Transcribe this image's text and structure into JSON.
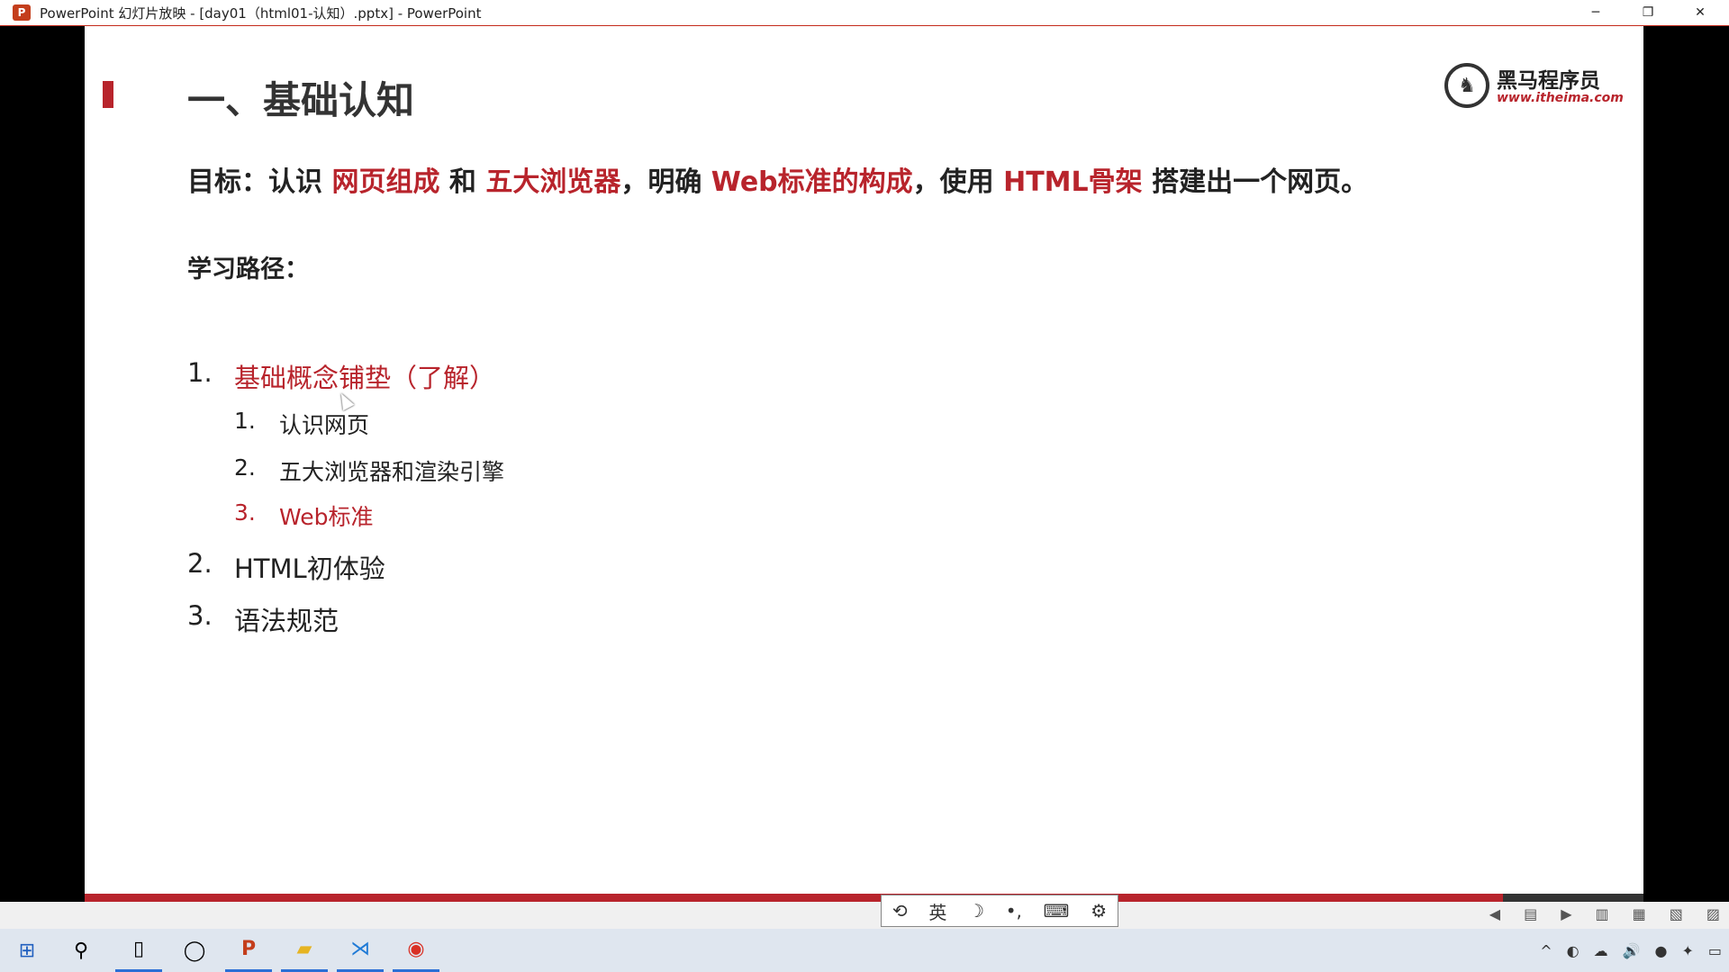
{
  "window": {
    "title": "PowerPoint 幻灯片放映 - [day01（html01-认知）.pptx] - PowerPoint",
    "app_icon": "P",
    "minimize": "─",
    "restore": "❐",
    "close": "✕"
  },
  "slide": {
    "heading": "一、基础认知",
    "logo": {
      "name": "黑马程序员",
      "url": "www.itheima.com",
      "icon": "horse-logo-icon"
    },
    "goal": {
      "p1": "目标：认识 ",
      "h1": "网页组成",
      "p2": " 和 ",
      "h2": "五大浏览器",
      "p3": "，明确 ",
      "h3": "Web标准的构成",
      "p4": "，使用 ",
      "h4": "HTML骨架",
      "p5": " 搭建出一个网页。"
    },
    "path_label": "学习路径：",
    "outline": [
      {
        "num": "1.",
        "text": "基础概念铺垫（了解）",
        "children": [
          {
            "num": "1.",
            "text": "认识网页"
          },
          {
            "num": "2.",
            "text": "五大浏览器和渲染引擎"
          },
          {
            "num": "3.",
            "text": "Web标准"
          }
        ]
      },
      {
        "num": "2.",
        "text": "HTML初体验"
      },
      {
        "num": "3.",
        "text": "语法规范"
      }
    ],
    "progress": 0.91
  },
  "ime_toolbar": {
    "logo": "⟲",
    "lang": "英",
    "moon": "☽",
    "punct": "•,",
    "keyboard": "⌨",
    "settings": "⚙"
  },
  "status_icons": [
    "◀",
    "▤",
    "▶",
    "▥",
    "▦",
    "▧",
    "▨"
  ],
  "taskbar": {
    "start": "⊞",
    "search": "⚲",
    "apps": [
      {
        "name": "notes",
        "glyph": "▯"
      },
      {
        "name": "cortana",
        "glyph": "◯"
      },
      {
        "name": "powerpoint",
        "glyph": "P"
      },
      {
        "name": "explorer",
        "glyph": "▰"
      },
      {
        "name": "vscode",
        "glyph": "⋊"
      },
      {
        "name": "chrome",
        "glyph": "◉"
      }
    ],
    "tray": [
      "^",
      "◐",
      "☁",
      "🔊",
      "●",
      "✦",
      "▭"
    ]
  },
  "colors": {
    "accent": "#b8242c",
    "text": "#222222"
  }
}
